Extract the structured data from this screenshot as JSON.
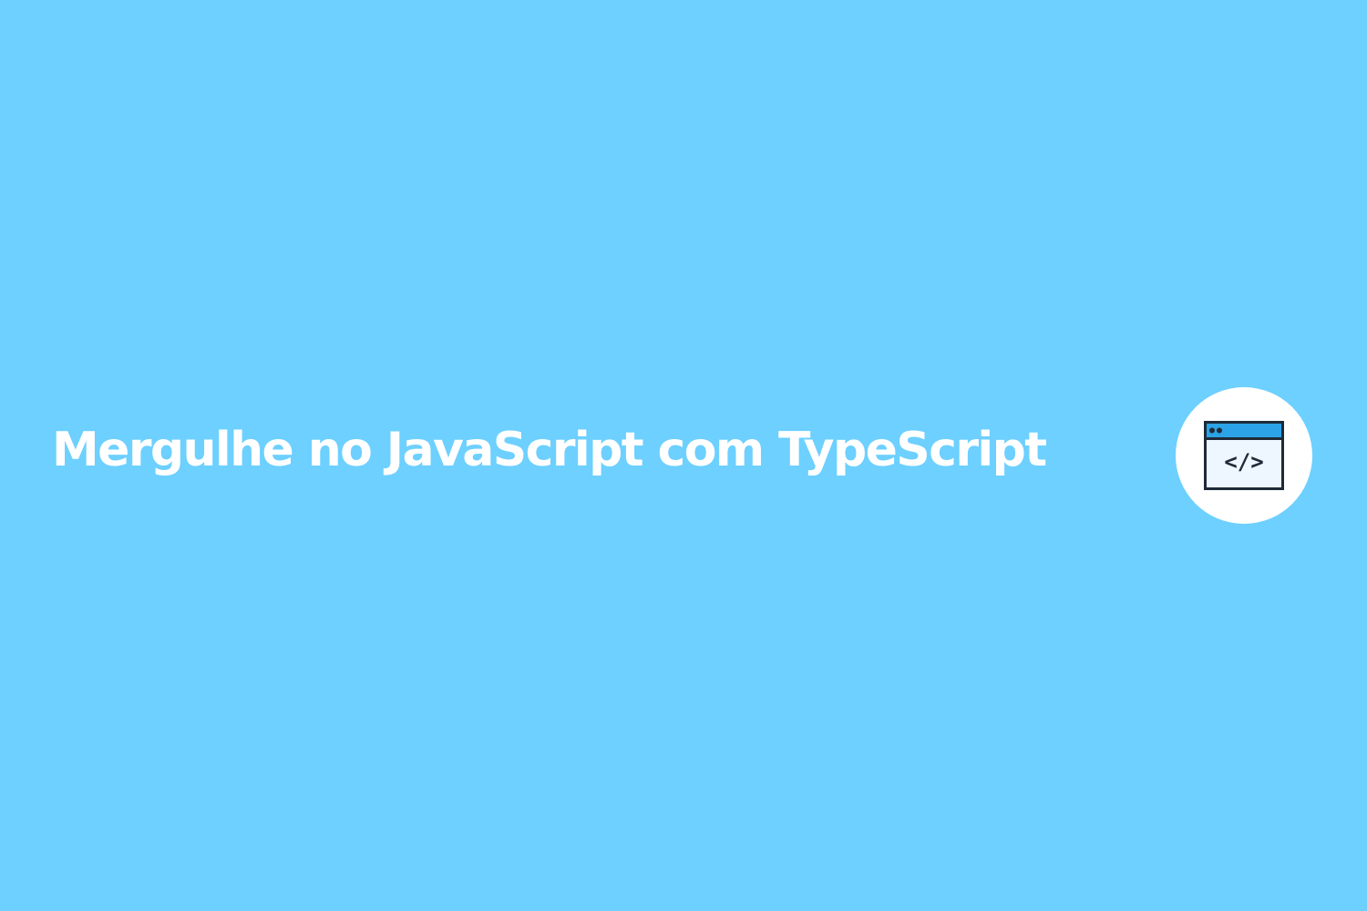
{
  "banner": {
    "title": "Mergulhe no JavaScript com TypeScript",
    "background_color": "#6dd0ff",
    "title_color": "#ffffff",
    "badge_color": "#ffffff",
    "icon": {
      "name": "code-window-icon",
      "frame_color": "#1f2a38",
      "titlebar_color": "#2ba3e6",
      "body_color": "#eef7ff",
      "glyph": "</>"
    }
  }
}
